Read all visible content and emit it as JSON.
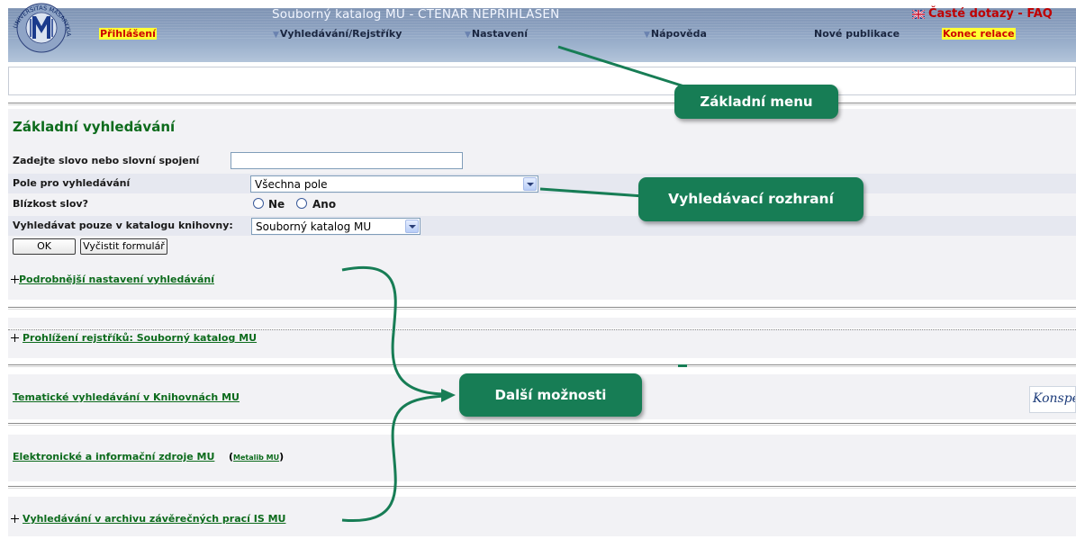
{
  "header": {
    "title": "Souborný katalog MU - ČTENÁŘ NEPŘIHLÁŠEN",
    "faq": "Časté dotazy - FAQ",
    "logo": "UNIVERSITAS MASARYKIANA BRUNENSIS",
    "menu": {
      "login": "Přihlášení",
      "search": "Vyhledávání/Rejstříky",
      "settings": "Nastavení",
      "help": "Nápověda",
      "new_publications": "Nové publikace",
      "end_session": "Konec relace"
    }
  },
  "search": {
    "title": "Základní vyhledávání",
    "keyword_label": "Zadejte slovo nebo slovní spojení",
    "keyword_value": "",
    "fields_label": "Pole pro vyhledávání",
    "fields_value": "Všechna pole",
    "proximity_label": "Blízkost slov?",
    "proximity_options": [
      "Ne",
      "Ano"
    ],
    "catalog_label": "Vyhledávat pouze v katalogu knihovny:",
    "catalog_value": "Souborný katalog MU",
    "ok_button": "OK",
    "clear_button": "Vyčistit formulář"
  },
  "links": {
    "advanced": "Podrobnější nastavení vyhledávání",
    "index": "Prohlížení rejstříků: Souborný katalog MU",
    "thematic": "Tematické vyhledávání v Knihovnách MU",
    "eres": "Elektronické a informační zdroje MU",
    "metalib": "Metalib MU",
    "archive": "Vyhledávání v archivu závěrečných prací IS MU",
    "konspekt": "Konspekt"
  },
  "callouts": {
    "menu": "Základní menu",
    "search_interface": "Vyhledávací rozhraní",
    "more": "Další možnosti"
  },
  "colors": {
    "callout": "#177d55",
    "link_green": "#0c6b1c",
    "header_blue": "#8a9fbe",
    "highlight_yellow": "#ffff33",
    "faq_red": "#c00000"
  }
}
